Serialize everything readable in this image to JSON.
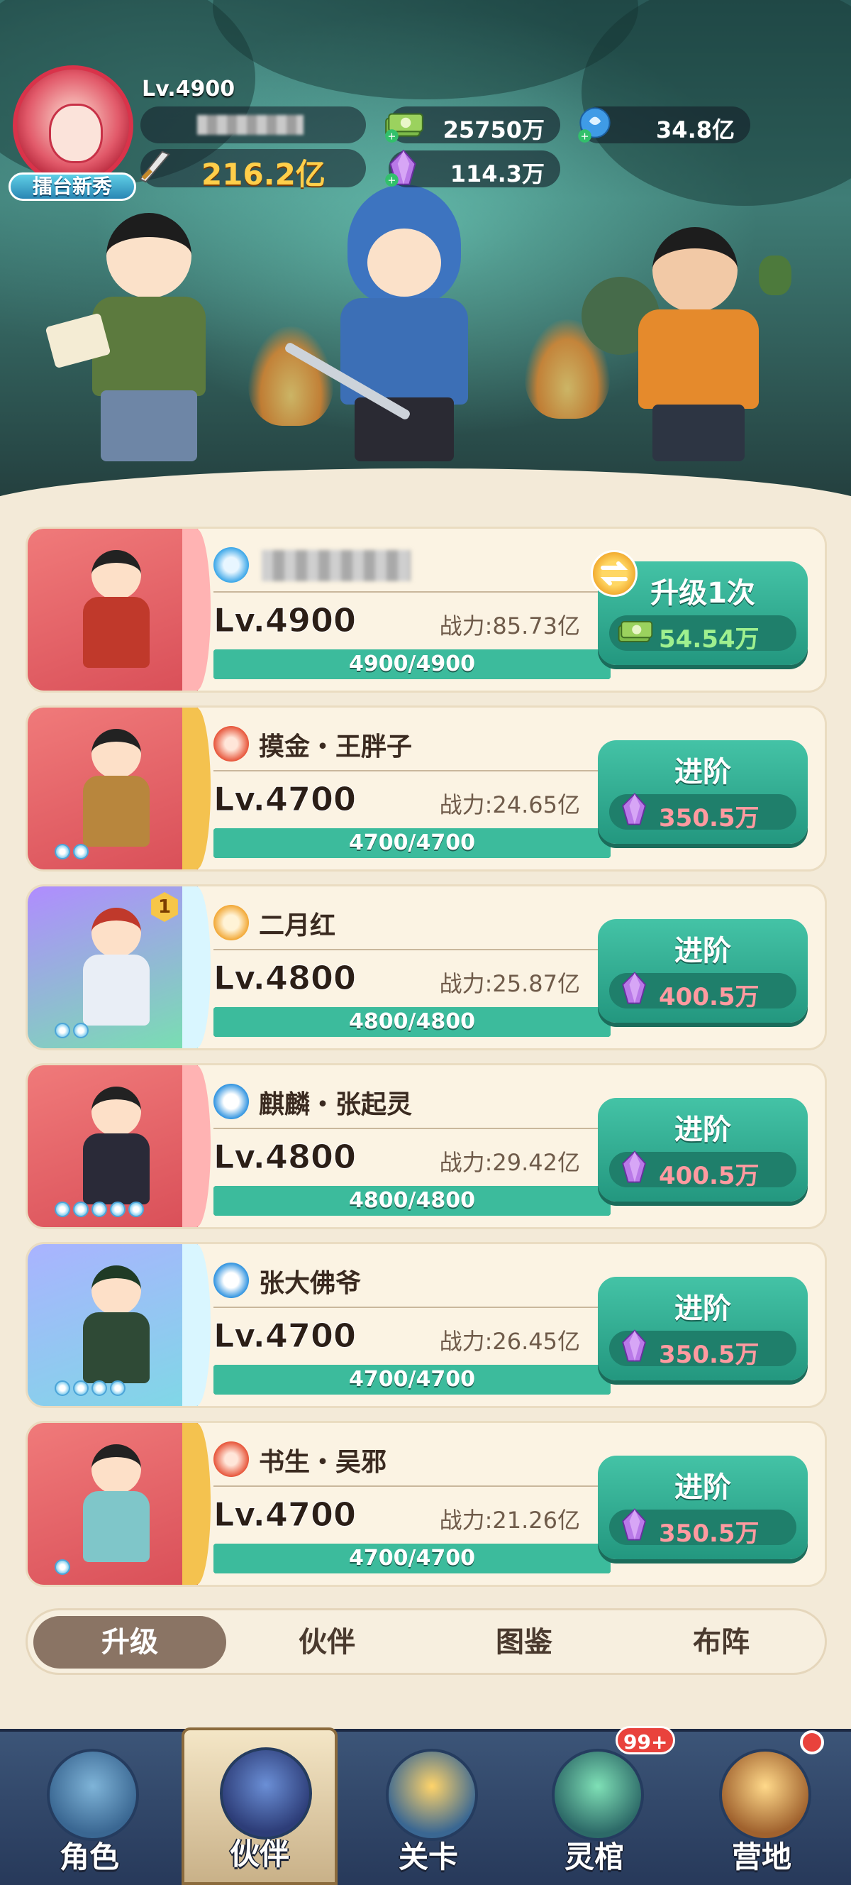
{
  "player": {
    "level": "Lv.4900",
    "title_badge": "擂台新秀",
    "power": "216.2亿",
    "avatar_icon": "opera-mask-avatar-icon",
    "name_blurred": true
  },
  "resources": {
    "gold": {
      "value": "25750万",
      "icon": "cash-stack-icon"
    },
    "gem": {
      "value": "114.3万",
      "icon": "purple-crystal-icon"
    },
    "blue": {
      "value": "34.8亿",
      "icon": "blue-orb-icon"
    }
  },
  "partners": [
    {
      "name": "",
      "name_blurred": true,
      "type_icon": "wind-swirl-icon",
      "level": "Lv.4900",
      "power": "战力:85.73亿",
      "progress": "4900/4900",
      "progress_frac": 1.0,
      "action": "升级1次",
      "cost": "54.54万",
      "cost_icon": "cash-stack-icon",
      "stars": 0,
      "badge": ""
    },
    {
      "name": "摸金・王胖子",
      "type_icon": "fire-swirl-icon",
      "level": "Lv.4700",
      "power": "战力:24.65亿",
      "progress": "4700/4700",
      "progress_frac": 1.0,
      "action": "进阶",
      "cost": "350.5万",
      "cost_icon": "purple-crystal-icon",
      "stars": 2,
      "badge": ""
    },
    {
      "name": "二月红",
      "type_icon": "earth-cloud-icon",
      "level": "Lv.4800",
      "power": "战力:25.87亿",
      "progress": "4800/4800",
      "progress_frac": 1.0,
      "action": "进阶",
      "cost": "400.5万",
      "cost_icon": "purple-crystal-icon",
      "stars": 2,
      "badge": "1"
    },
    {
      "name": "麒麟・张起灵",
      "type_icon": "water-s-icon",
      "level": "Lv.4800",
      "power": "战力:29.42亿",
      "progress": "4800/4800",
      "progress_frac": 1.0,
      "action": "进阶",
      "cost": "400.5万",
      "cost_icon": "purple-crystal-icon",
      "stars": 5,
      "badge": ""
    },
    {
      "name": "张大佛爷",
      "type_icon": "water-s-icon",
      "level": "Lv.4700",
      "power": "战力:26.45亿",
      "progress": "4700/4700",
      "progress_frac": 1.0,
      "action": "进阶",
      "cost": "350.5万",
      "cost_icon": "purple-crystal-icon",
      "stars": 4,
      "badge": ""
    },
    {
      "name": "书生・吴邪",
      "type_icon": "fire-swirl-icon",
      "level": "Lv.4700",
      "power": "战力:21.26亿",
      "progress": "4700/4700",
      "progress_frac": 1.0,
      "action": "进阶",
      "cost": "350.5万",
      "cost_icon": "purple-crystal-icon",
      "stars": 1,
      "badge": ""
    }
  ],
  "subtabs": [
    "升级",
    "伙伴",
    "图鉴",
    "布阵"
  ],
  "nav": [
    {
      "label": "角色",
      "icon": "character-icon"
    },
    {
      "label": "伙伴",
      "icon": "partner-icon",
      "active": true
    },
    {
      "label": "关卡",
      "icon": "sword-stage-icon"
    },
    {
      "label": "灵棺",
      "icon": "coffin-icon",
      "badge": "99+"
    },
    {
      "label": "营地",
      "icon": "tent-camp-icon",
      "dot": true
    }
  ],
  "colors": {
    "accent_green": "#2fa88c",
    "tab_active": "#8a7464",
    "nav_bg": "#2f4468"
  }
}
